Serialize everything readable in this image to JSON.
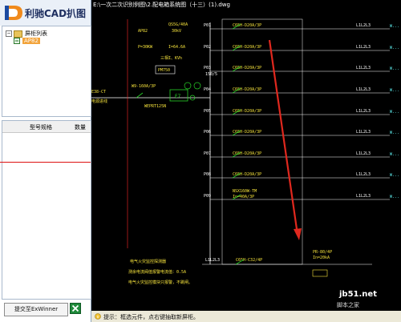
{
  "app": {
    "title": "利驰CAD扒图"
  },
  "file_tree": {
    "root_label": "屏柜列表",
    "selected_item": "AP82"
  },
  "grid": {
    "col_model": "型号规格",
    "col_qty": "数量"
  },
  "submit_button": "提交至ExWinner",
  "drawing": {
    "title": "E:\\一次二次识别例图\\2.配电箱系统图（十三）(1).dwg",
    "panel_id": "AP82",
    "incoming_model": "QS5G/40A",
    "incoming_rating": "30kV",
    "power": "P=30KW",
    "current": "I=64.6A",
    "phase": "三相I、KVh",
    "ct_model": "PM750",
    "ct_ratio": "150/5",
    "main_breaker": "W9-160A/3P",
    "meter": "E7",
    "meter_model": "WEPRT125N",
    "feeder_label": "E38-CT",
    "feeder_note": "电源进线",
    "spare_model": "NSX160W-TM",
    "spare_rating": "In=40A/3P",
    "bottom_line": "L1L2L3",
    "bottom_breaker": "C65H-C32/4P",
    "fuse_model": "PR-80/4P",
    "fuse_rating": "In=20kA",
    "notes": [
      "电气火灾监控探测器",
      "测余电流阀值报警电流值：0.5A",
      "电气火灾监控模块只报警，不跳闸。"
    ],
    "circuits": [
      {
        "id": "P01",
        "breaker": "C65H-D20A/3P",
        "phase": "L1L2L3"
      },
      {
        "id": "P02",
        "breaker": "C65H-D20A/3P",
        "phase": "L1L2L3"
      },
      {
        "id": "P03",
        "breaker": "C65H-D20A/3P",
        "phase": "L1L2L3"
      },
      {
        "id": "P04",
        "breaker": "C65H-D20A/3P",
        "phase": "L1L2L3"
      },
      {
        "id": "P05",
        "breaker": "C65H-D20A/3P",
        "phase": "L1L2L3"
      },
      {
        "id": "P06",
        "breaker": "C65H-D20A/3P",
        "phase": "L1L2L3"
      },
      {
        "id": "P07",
        "breaker": "C65H-D20A/3P",
        "phase": "L1L2L3"
      },
      {
        "id": "P08",
        "breaker": "C65H-D20A/3P",
        "phase": "L1L2L3"
      },
      {
        "id": "P09",
        "breaker": "",
        "phase": "L1L2L3"
      }
    ]
  },
  "status": {
    "text": "提示：框选元件，点右键抽取新屏柜。"
  },
  "watermark": {
    "main": "jb51.net",
    "sub": "脚本之家"
  },
  "colors": {
    "canvas": "#000000",
    "line": "#ffffff",
    "text_cyan": "#5ff0f0",
    "text_yellow": "#f5e23c",
    "green": "#27d327",
    "red": "#ff2a2a",
    "arrow": "#e0281e"
  }
}
